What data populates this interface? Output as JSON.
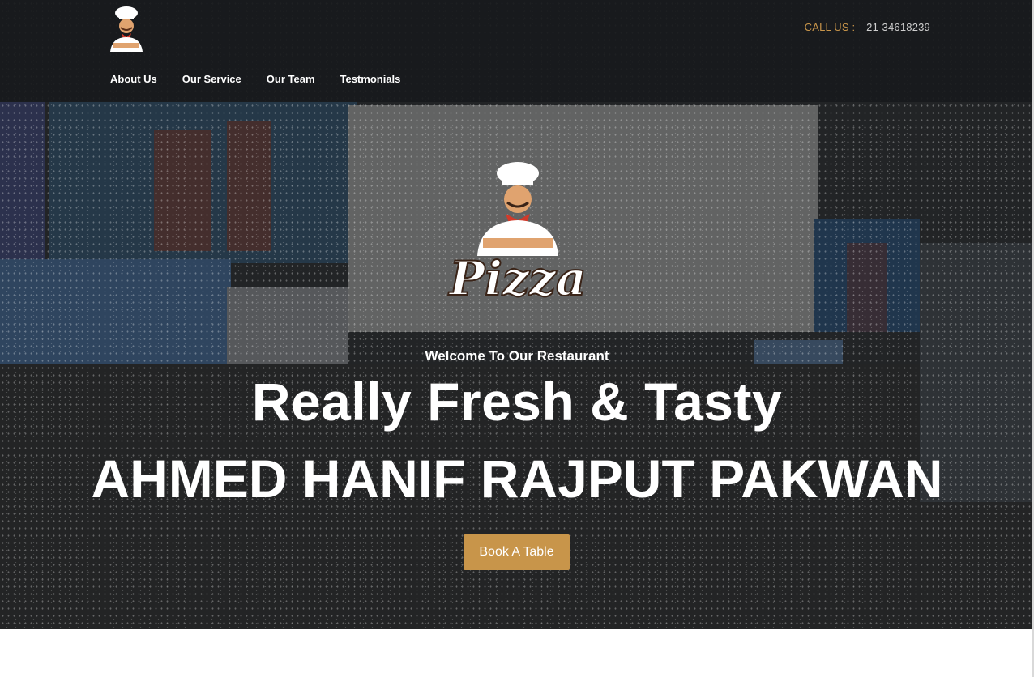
{
  "header": {
    "logo_icon": "chef-logo-icon",
    "call_label": "CALL US :",
    "call_number": "21-34618239"
  },
  "nav": {
    "items": [
      {
        "label": "About Us"
      },
      {
        "label": "Our Service"
      },
      {
        "label": "Our Team"
      },
      {
        "label": "Testmonials"
      }
    ]
  },
  "hero": {
    "logo_icon": "chef-pizza-logo-icon",
    "logo_word": "Pizza",
    "welcome": "Welcome To Our Restaurant",
    "headline": "Really Fresh & Tasty",
    "name": "AHMED HANIF RAJPUT PAKWAN",
    "cta_label": "Book A Table"
  },
  "colors": {
    "accent": "#c8954a",
    "dark": "#1f2123",
    "text": "#ffffff"
  }
}
